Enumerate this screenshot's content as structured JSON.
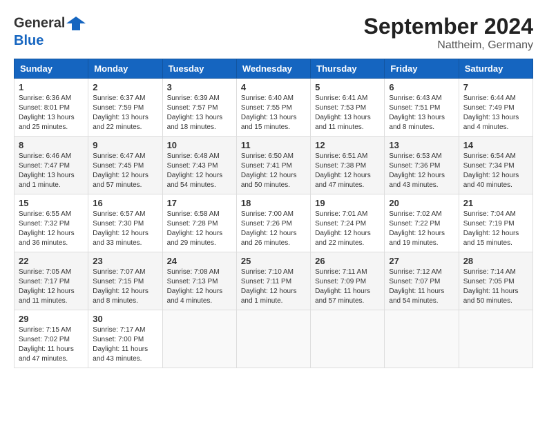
{
  "header": {
    "logo_line1": "General",
    "logo_line2": "Blue",
    "month_year": "September 2024",
    "location": "Nattheim, Germany"
  },
  "weekdays": [
    "Sunday",
    "Monday",
    "Tuesday",
    "Wednesday",
    "Thursday",
    "Friday",
    "Saturday"
  ],
  "weeks": [
    [
      {
        "day": "1",
        "info": "Sunrise: 6:36 AM\nSunset: 8:01 PM\nDaylight: 13 hours\nand 25 minutes."
      },
      {
        "day": "2",
        "info": "Sunrise: 6:37 AM\nSunset: 7:59 PM\nDaylight: 13 hours\nand 22 minutes."
      },
      {
        "day": "3",
        "info": "Sunrise: 6:39 AM\nSunset: 7:57 PM\nDaylight: 13 hours\nand 18 minutes."
      },
      {
        "day": "4",
        "info": "Sunrise: 6:40 AM\nSunset: 7:55 PM\nDaylight: 13 hours\nand 15 minutes."
      },
      {
        "day": "5",
        "info": "Sunrise: 6:41 AM\nSunset: 7:53 PM\nDaylight: 13 hours\nand 11 minutes."
      },
      {
        "day": "6",
        "info": "Sunrise: 6:43 AM\nSunset: 7:51 PM\nDaylight: 13 hours\nand 8 minutes."
      },
      {
        "day": "7",
        "info": "Sunrise: 6:44 AM\nSunset: 7:49 PM\nDaylight: 13 hours\nand 4 minutes."
      }
    ],
    [
      {
        "day": "8",
        "info": "Sunrise: 6:46 AM\nSunset: 7:47 PM\nDaylight: 13 hours\nand 1 minute."
      },
      {
        "day": "9",
        "info": "Sunrise: 6:47 AM\nSunset: 7:45 PM\nDaylight: 12 hours\nand 57 minutes."
      },
      {
        "day": "10",
        "info": "Sunrise: 6:48 AM\nSunset: 7:43 PM\nDaylight: 12 hours\nand 54 minutes."
      },
      {
        "day": "11",
        "info": "Sunrise: 6:50 AM\nSunset: 7:41 PM\nDaylight: 12 hours\nand 50 minutes."
      },
      {
        "day": "12",
        "info": "Sunrise: 6:51 AM\nSunset: 7:38 PM\nDaylight: 12 hours\nand 47 minutes."
      },
      {
        "day": "13",
        "info": "Sunrise: 6:53 AM\nSunset: 7:36 PM\nDaylight: 12 hours\nand 43 minutes."
      },
      {
        "day": "14",
        "info": "Sunrise: 6:54 AM\nSunset: 7:34 PM\nDaylight: 12 hours\nand 40 minutes."
      }
    ],
    [
      {
        "day": "15",
        "info": "Sunrise: 6:55 AM\nSunset: 7:32 PM\nDaylight: 12 hours\nand 36 minutes."
      },
      {
        "day": "16",
        "info": "Sunrise: 6:57 AM\nSunset: 7:30 PM\nDaylight: 12 hours\nand 33 minutes."
      },
      {
        "day": "17",
        "info": "Sunrise: 6:58 AM\nSunset: 7:28 PM\nDaylight: 12 hours\nand 29 minutes."
      },
      {
        "day": "18",
        "info": "Sunrise: 7:00 AM\nSunset: 7:26 PM\nDaylight: 12 hours\nand 26 minutes."
      },
      {
        "day": "19",
        "info": "Sunrise: 7:01 AM\nSunset: 7:24 PM\nDaylight: 12 hours\nand 22 minutes."
      },
      {
        "day": "20",
        "info": "Sunrise: 7:02 AM\nSunset: 7:22 PM\nDaylight: 12 hours\nand 19 minutes."
      },
      {
        "day": "21",
        "info": "Sunrise: 7:04 AM\nSunset: 7:19 PM\nDaylight: 12 hours\nand 15 minutes."
      }
    ],
    [
      {
        "day": "22",
        "info": "Sunrise: 7:05 AM\nSunset: 7:17 PM\nDaylight: 12 hours\nand 11 minutes."
      },
      {
        "day": "23",
        "info": "Sunrise: 7:07 AM\nSunset: 7:15 PM\nDaylight: 12 hours\nand 8 minutes."
      },
      {
        "day": "24",
        "info": "Sunrise: 7:08 AM\nSunset: 7:13 PM\nDaylight: 12 hours\nand 4 minutes."
      },
      {
        "day": "25",
        "info": "Sunrise: 7:10 AM\nSunset: 7:11 PM\nDaylight: 12 hours\nand 1 minute."
      },
      {
        "day": "26",
        "info": "Sunrise: 7:11 AM\nSunset: 7:09 PM\nDaylight: 11 hours\nand 57 minutes."
      },
      {
        "day": "27",
        "info": "Sunrise: 7:12 AM\nSunset: 7:07 PM\nDaylight: 11 hours\nand 54 minutes."
      },
      {
        "day": "28",
        "info": "Sunrise: 7:14 AM\nSunset: 7:05 PM\nDaylight: 11 hours\nand 50 minutes."
      }
    ],
    [
      {
        "day": "29",
        "info": "Sunrise: 7:15 AM\nSunset: 7:02 PM\nDaylight: 11 hours\nand 47 minutes."
      },
      {
        "day": "30",
        "info": "Sunrise: 7:17 AM\nSunset: 7:00 PM\nDaylight: 11 hours\nand 43 minutes."
      },
      {
        "day": "",
        "info": ""
      },
      {
        "day": "",
        "info": ""
      },
      {
        "day": "",
        "info": ""
      },
      {
        "day": "",
        "info": ""
      },
      {
        "day": "",
        "info": ""
      }
    ]
  ]
}
